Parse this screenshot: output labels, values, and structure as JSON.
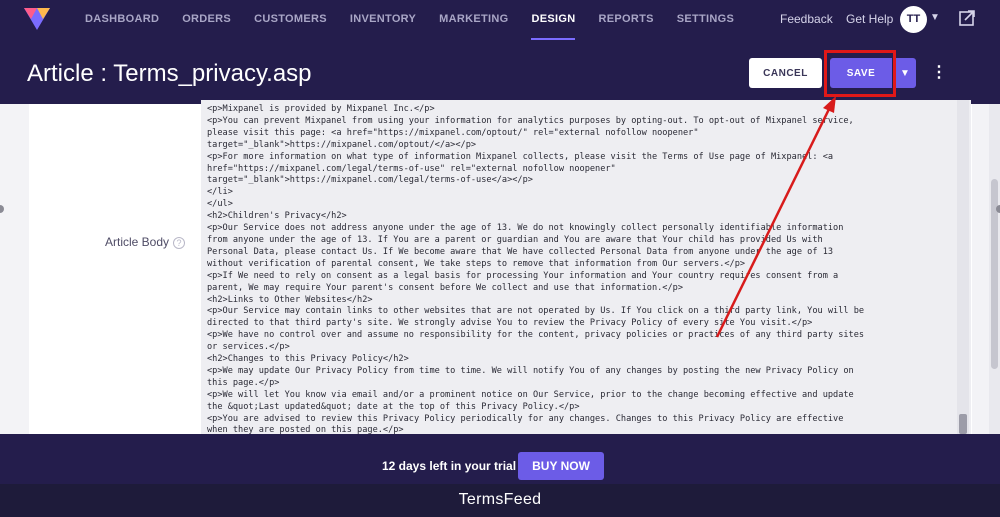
{
  "nav": {
    "items": [
      {
        "label": "DASHBOARD",
        "active": false
      },
      {
        "label": "ORDERS",
        "active": false
      },
      {
        "label": "CUSTOMERS",
        "active": false
      },
      {
        "label": "INVENTORY",
        "active": false
      },
      {
        "label": "MARKETING",
        "active": false
      },
      {
        "label": "DESIGN",
        "active": true
      },
      {
        "label": "REPORTS",
        "active": false
      },
      {
        "label": "SETTINGS",
        "active": false
      }
    ],
    "feedback": "Feedback",
    "get_help": "Get Help",
    "avatar_initials": "TT",
    "logo_icon": "volusion-logo-icon",
    "external_icon": "external-link-icon"
  },
  "header": {
    "title": "Article : Terms_privacy.asp",
    "cancel_label": "CANCEL",
    "save_label": "SAVE",
    "dropdown_icon": "chevron-down-icon",
    "more_icon": "kebab-menu-icon"
  },
  "form": {
    "label": "Article Body",
    "help_icon": "?",
    "editor_lines": [
      "<p>Mixpanel is provided by Mixpanel Inc.</p>",
      "<p>You can prevent Mixpanel from using your information for analytics purposes by opting-out. To opt-out of Mixpanel service,",
      "please visit this page: <a href=\"https://mixpanel.com/optout/\" rel=\"external nofollow noopener\"",
      "target=\"_blank\">https://mixpanel.com/optout/</a></p>",
      "<p>For more information on what type of information Mixpanel collects, please visit the Terms of Use page of Mixpanel: <a",
      "href=\"https://mixpanel.com/legal/terms-of-use\" rel=\"external nofollow noopener\"",
      "target=\"_blank\">https://mixpanel.com/legal/terms-of-use</a></p>",
      "</li>",
      "</ul>",
      "<h2>Children's Privacy</h2>",
      "<p>Our Service does not address anyone under the age of 13. We do not knowingly collect personally identifiable information",
      "from anyone under the age of 13. If You are a parent or guardian and You are aware that Your child has provided Us with",
      "Personal Data, please contact Us. If We become aware that We have collected Personal Data from anyone under the age of 13",
      "without verification of parental consent, We take steps to remove that information from Our servers.</p>",
      "<p>If We need to rely on consent as a legal basis for processing Your information and Your country requires consent from a",
      "parent, We may require Your parent's consent before We collect and use that information.</p>",
      "<h2>Links to Other Websites</h2>",
      "<p>Our Service may contain links to other websites that are not operated by Us. If You click on a third party link, You will be",
      "directed to that third party's site. We strongly advise You to review the Privacy Policy of every site You visit.</p>",
      "<p>We have no control over and assume no responsibility for the content, privacy policies or practices of any third party sites",
      "or services.</p>",
      "<h2>Changes to this Privacy Policy</h2>",
      "<p>We may update Our Privacy Policy from time to time. We will notify You of any changes by posting the new Privacy Policy on",
      "this page.</p>",
      "<p>We will let You know via email and/or a prominent notice on Our Service, prior to the change becoming effective and update",
      "the &quot;Last updated&quot; date at the top of this Privacy Policy.</p>",
      "<p>You are advised to review this Privacy Policy periodically for any changes. Changes to this Privacy Policy are effective",
      "when they are posted on this page.</p>"
    ]
  },
  "trial": {
    "text": "12 days left in your trial",
    "buy_label": "BUY NOW"
  },
  "caption": "TermsFeed",
  "colors": {
    "nav_bg": "#241d4c",
    "accent": "#6c5ce7",
    "highlight": "#e01818"
  }
}
